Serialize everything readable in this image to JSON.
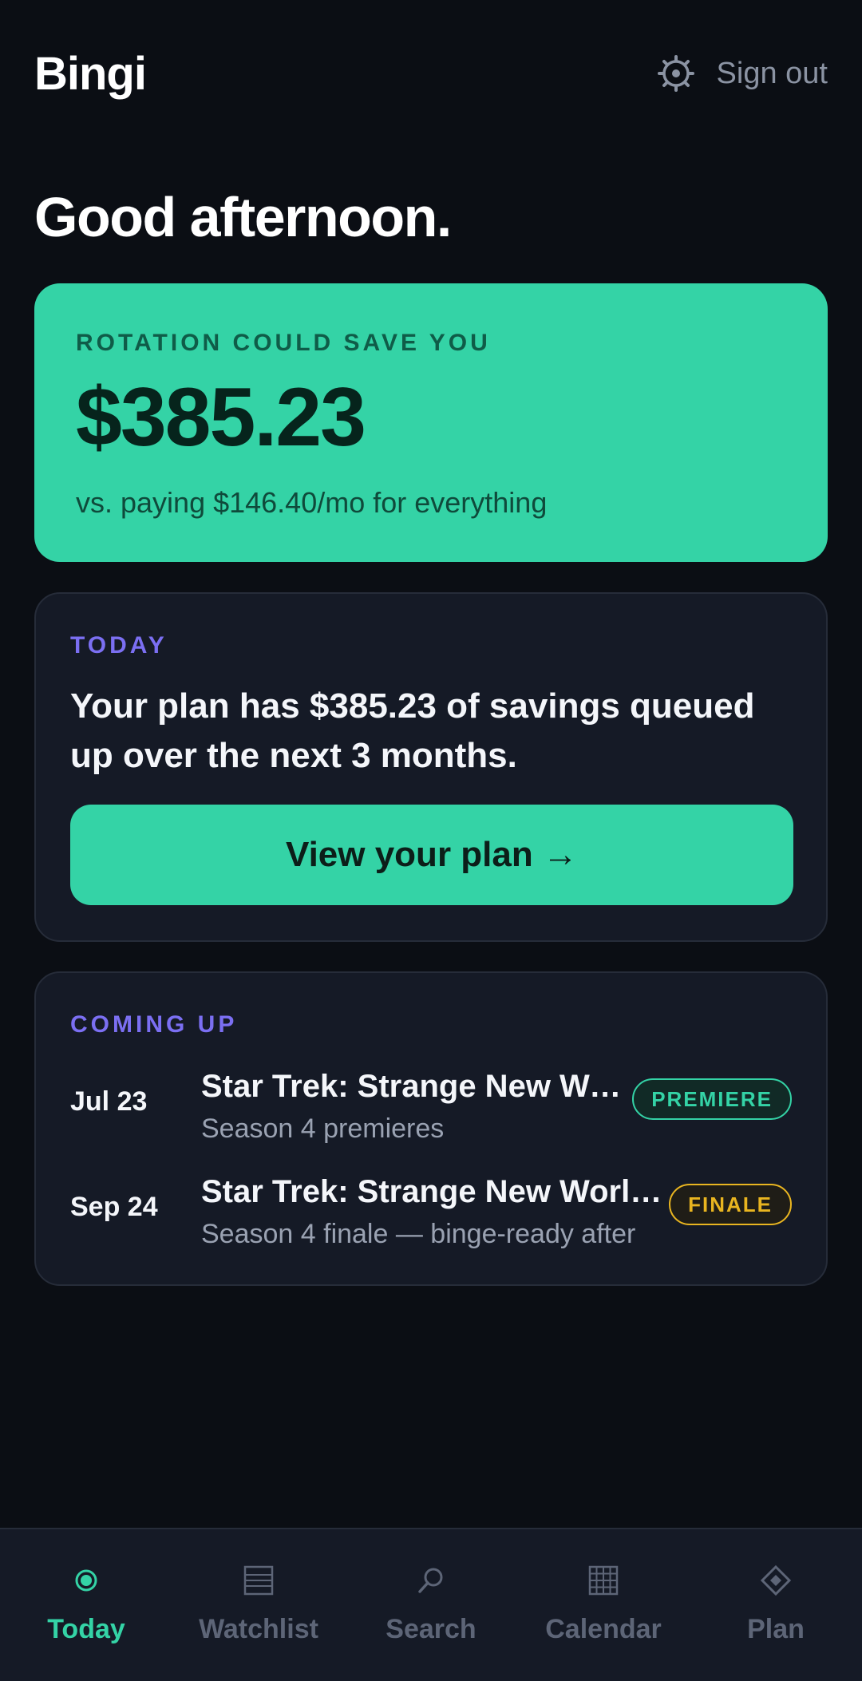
{
  "app": {
    "brand": "Bingi",
    "sign_out": "Sign out"
  },
  "greeting": "Good afternoon.",
  "savings": {
    "kicker": "ROTATION COULD SAVE YOU",
    "amount": "$385.23",
    "subtitle": "vs. paying $146.40/mo for everything"
  },
  "today": {
    "kicker": "TODAY",
    "message": "Your plan has $385.23 of savings queued up over the next 3 months.",
    "button": "View your plan →"
  },
  "coming_up": {
    "kicker": "COMING UP",
    "events": [
      {
        "date": "Jul 23",
        "title": "Star Trek: Strange New Worlds",
        "subtitle": "Season 4 premieres",
        "badge": "PREMIERE"
      },
      {
        "date": "Sep 24",
        "title": "Star Trek: Strange New Worlds",
        "subtitle": "Season 4 finale — binge-ready after",
        "badge": "FINALE"
      }
    ]
  },
  "tabs": [
    {
      "label": "Today",
      "icon": "radio-dot-icon",
      "active": true
    },
    {
      "label": "Watchlist",
      "icon": "list-icon",
      "active": false
    },
    {
      "label": "Search",
      "icon": "search-icon",
      "active": false
    },
    {
      "label": "Calendar",
      "icon": "calendar-grid-icon",
      "active": false
    },
    {
      "label": "Plan",
      "icon": "diamond-icon",
      "active": false
    }
  ],
  "colors": {
    "background": "#0b0e14",
    "accent": "#34d3a6",
    "kicker": "#7b6ff2",
    "finale": "#e9b520",
    "muted": "#5d6577"
  }
}
